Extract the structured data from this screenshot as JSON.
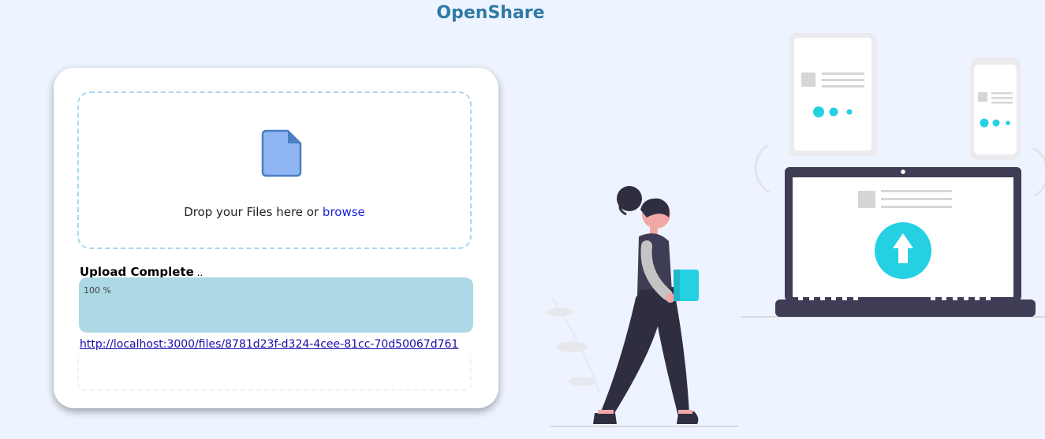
{
  "app": {
    "title": "OpenShare"
  },
  "dropzone": {
    "text": "Drop your Files here or ",
    "browse_label": "browse",
    "icon": "file-icon"
  },
  "upload": {
    "status_label": "Upload Complete",
    "status_suffix": " ..",
    "progress": 100,
    "progress_text": "100 %",
    "link": "http://localhost:3000/files/8781d23f-d324-4cee-81cc-70d50067d761"
  },
  "colors": {
    "title": "#2f7aa6",
    "progress_fill": "#add8e6",
    "accent": "#26d0e3",
    "dark": "#3f3d56",
    "background": "#eef4ff"
  }
}
